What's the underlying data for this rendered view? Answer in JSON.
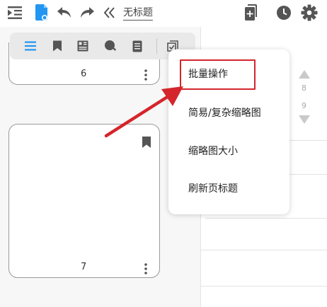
{
  "toolbar": {
    "doc_title": "无标题",
    "icons": [
      "sidebar-toggle-icon",
      "document-icon",
      "undo-icon",
      "redo-icon",
      "double-chevron-left-icon",
      "add-page-icon",
      "clock-icon",
      "gear-icon"
    ]
  },
  "thumbnail_toolbar": {
    "icons": [
      "list-icon",
      "bookmark-icon",
      "layout-icon",
      "search-icon",
      "notes-icon",
      "checklist-icon"
    ],
    "active": "list-icon",
    "active_color": "#2196f3"
  },
  "pages": [
    {
      "number": "6"
    },
    {
      "number": "7",
      "bookmarked": true
    }
  ],
  "page_nav": {
    "numbers": [
      "8",
      "9"
    ]
  },
  "popup_menu": {
    "items": [
      {
        "label": "批量操作"
      },
      {
        "label": "简易/复杂缩略图"
      },
      {
        "label": "缩略图大小"
      },
      {
        "label": "刷新页标题"
      }
    ],
    "highlighted": "批量操作",
    "highlight_color": "#d4262c"
  },
  "annotation": {
    "arrow_color": "#d4262c"
  }
}
